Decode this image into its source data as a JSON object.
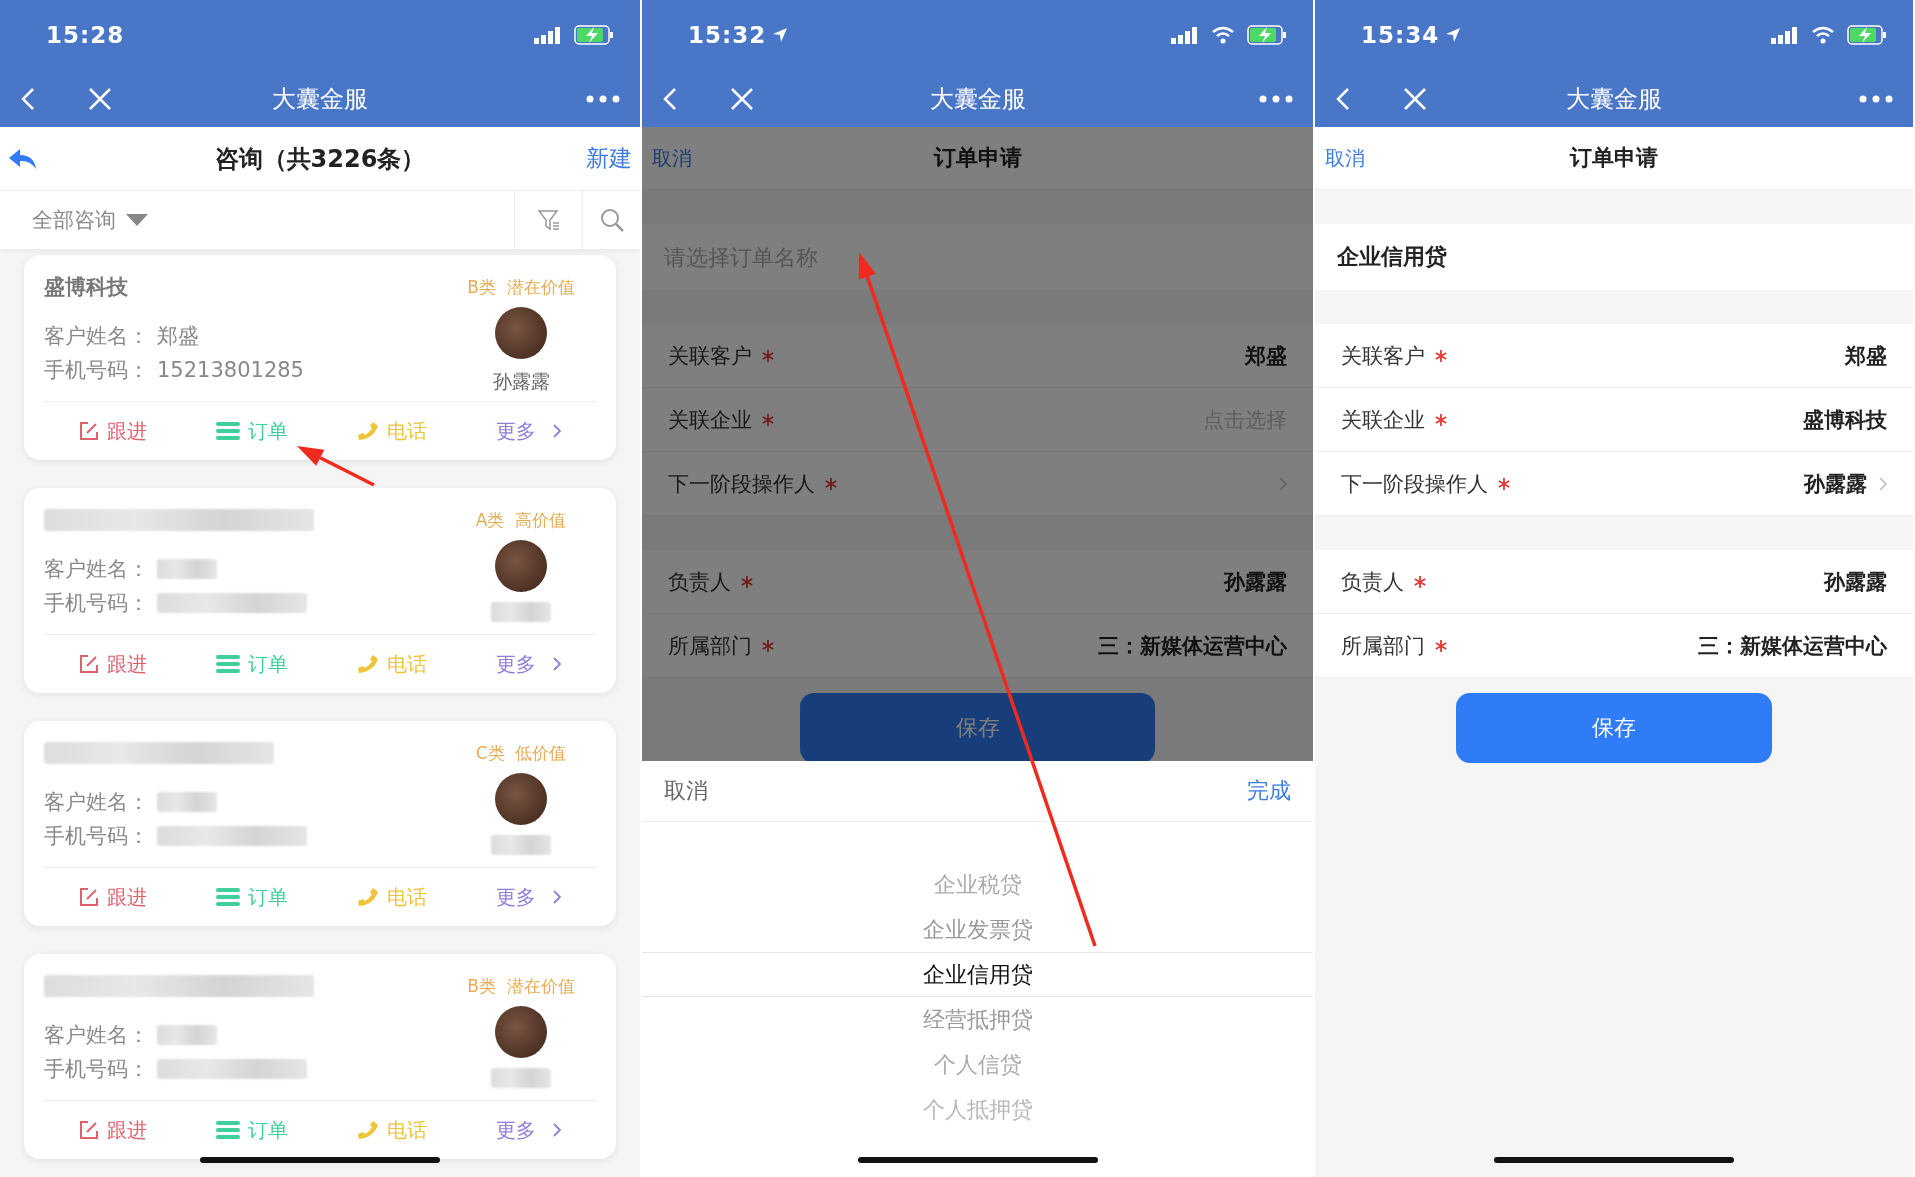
{
  "phones": [
    {
      "kind": "list",
      "status_bar": {
        "time": "15:28",
        "location": false,
        "wifi": false
      },
      "nav_bar": {
        "title": "大囊金服"
      },
      "header": {
        "title": "咨询（共3226条）",
        "action": "新建"
      },
      "filter": {
        "label": "全部咨询"
      },
      "cards": [
        {
          "company": "盛博科技",
          "tag": "B类  潜在价值",
          "fields": [
            {
              "label": "客户姓名：",
              "value": "郑盛"
            },
            {
              "label": "手机号码：",
              "value": "15213801285"
            }
          ],
          "owner": "孙露露",
          "actions": [
            {
              "kind": "follow",
              "label": "跟进",
              "color": "#e0606e"
            },
            {
              "kind": "order",
              "label": "订单",
              "color": "#3fcf9a"
            },
            {
              "kind": "call",
              "label": "电话",
              "color": "#eec43a"
            },
            {
              "kind": "more",
              "label": "更多",
              "color": "#8f7fdc"
            }
          ]
        },
        {
          "tag": "A类  高价值",
          "fields": [
            {
              "label": "客户姓名："
            },
            {
              "label": "手机号码："
            }
          ],
          "actions": [
            {
              "kind": "follow",
              "label": "跟进",
              "color": "#e0606e"
            },
            {
              "kind": "order",
              "label": "订单",
              "color": "#3fcf9a"
            },
            {
              "kind": "call",
              "label": "电话",
              "color": "#eec43a"
            },
            {
              "kind": "more",
              "label": "更多",
              "color": "#8f7fdc"
            }
          ]
        },
        {
          "tag": "C类  低价值",
          "fields": [
            {
              "label": "客户姓名："
            },
            {
              "label": "手机号码："
            }
          ],
          "actions": [
            {
              "kind": "follow",
              "label": "跟进",
              "color": "#e0606e"
            },
            {
              "kind": "order",
              "label": "订单",
              "color": "#3fcf9a"
            },
            {
              "kind": "call",
              "label": "电话",
              "color": "#eec43a"
            },
            {
              "kind": "more",
              "label": "更多",
              "color": "#8f7fdc"
            }
          ]
        },
        {
          "tag": "B类  潜在价值",
          "fields": [
            {
              "label": "客户姓名："
            },
            {
              "label": "手机号码："
            }
          ],
          "actions": [
            {
              "kind": "follow",
              "label": "跟进",
              "color": "#e0606e"
            },
            {
              "kind": "order",
              "label": "订单",
              "color": "#3fcf9a"
            },
            {
              "kind": "call",
              "label": "电话",
              "color": "#eec43a"
            },
            {
              "kind": "more",
              "label": "更多",
              "color": "#8f7fdc"
            }
          ]
        }
      ]
    },
    {
      "kind": "form",
      "status_bar": {
        "time": "15:32",
        "location": true,
        "wifi": true
      },
      "nav_bar": {
        "title": "大囊金服"
      },
      "form": {
        "cancel": "取消",
        "title": "订单申请",
        "name_field": {
          "placeholder": "请选择订单名称"
        },
        "groups": [
          [
            {
              "label": "关联客户",
              "required": true,
              "value": "郑盛"
            },
            {
              "label": "关联企业",
              "required": true,
              "placeholder": "点击选择"
            },
            {
              "label": "下一阶段操作人",
              "required": true,
              "chevron": true
            }
          ],
          [
            {
              "label": "负责人",
              "required": true,
              "value": "孙露露"
            },
            {
              "label": "所属部门",
              "required": true,
              "value": "三：新媒体运营中心"
            }
          ]
        ],
        "save": "保存"
      },
      "dimmed": true,
      "picker": {
        "cancel": "取消",
        "done": "完成",
        "options": [
          {
            "label": "企业税贷",
            "selected": false
          },
          {
            "label": "企业发票贷",
            "selected": false
          },
          {
            "label": "企业信用贷",
            "selected": true
          },
          {
            "label": "经营抵押贷",
            "selected": false
          },
          {
            "label": "个人信贷",
            "selected": false
          },
          {
            "label": "个人抵押贷",
            "selected": false
          }
        ]
      }
    },
    {
      "kind": "form",
      "status_bar": {
        "time": "15:34",
        "location": true,
        "wifi": true
      },
      "nav_bar": {
        "title": "大囊金服"
      },
      "form": {
        "cancel": "取消",
        "title": "订单申请",
        "name_field": {
          "value": "企业信用贷"
        },
        "groups": [
          [
            {
              "label": "关联客户",
              "required": true,
              "value": "郑盛"
            },
            {
              "label": "关联企业",
              "required": true,
              "value": "盛博科技"
            },
            {
              "label": "下一阶段操作人",
              "required": true,
              "value": "孙露露",
              "chevron": true
            }
          ],
          [
            {
              "label": "负责人",
              "required": true,
              "value": "孙露露"
            },
            {
              "label": "所属部门",
              "required": true,
              "value": "三：新媒体运营中心"
            }
          ]
        ],
        "save": "保存"
      },
      "dimmed": false
    }
  ]
}
